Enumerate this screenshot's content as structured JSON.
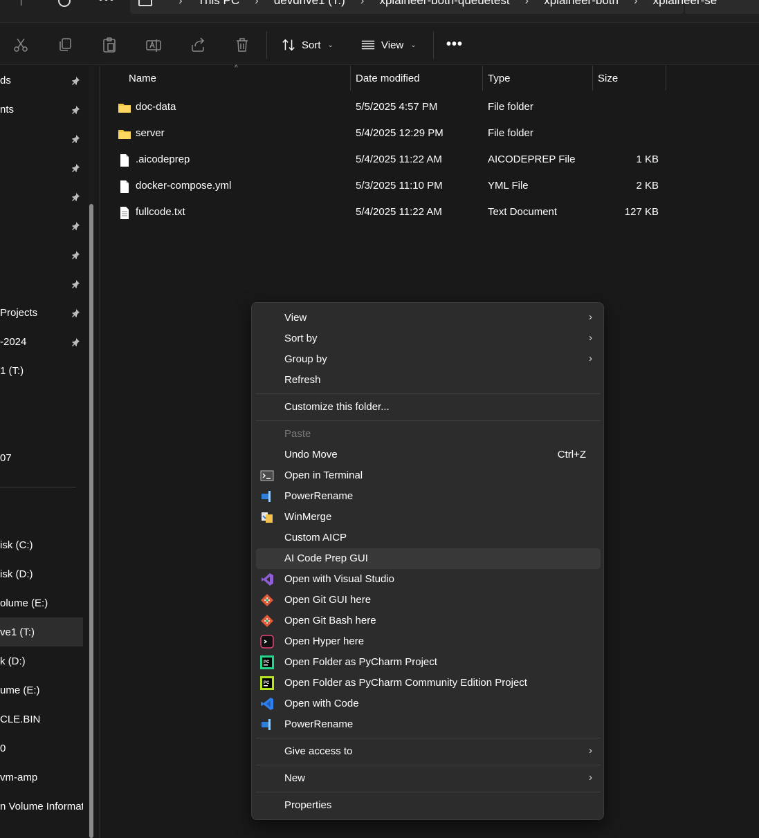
{
  "address_bar": {
    "crumbs": [
      "This PC",
      "devdrive1 (T:)",
      "xplaineer-both-queuetest",
      "xplaineer-both",
      "xplaineer-se"
    ]
  },
  "toolbar": {
    "icons": [
      "cut-icon",
      "copy-icon",
      "paste-icon",
      "rename-icon",
      "share-icon",
      "delete-icon"
    ],
    "sort_label": "Sort",
    "view_label": "View",
    "more_label": "•••"
  },
  "nav": {
    "items": [
      {
        "label": "ds",
        "pinned": true
      },
      {
        "label": "nts",
        "pinned": true
      },
      {
        "label": "",
        "pinned": true
      },
      {
        "label": "",
        "pinned": true
      },
      {
        "label": "",
        "pinned": true
      },
      {
        "label": "",
        "pinned": true
      },
      {
        "label": "",
        "pinned": true
      },
      {
        "label": "",
        "pinned": true
      },
      {
        "label": "Projects",
        "pinned": true
      },
      {
        "label": "-2024",
        "pinned": true
      },
      {
        "label": "1 (T:)",
        "pinned": false
      },
      {
        "label": "",
        "pinned": false
      },
      {
        "label": "",
        "pinned": false
      },
      {
        "label": "07",
        "pinned": false
      },
      {
        "label": "",
        "pinned": false
      },
      {
        "label": "",
        "pinned": false
      },
      {
        "label": "isk (C:)",
        "pinned": false
      },
      {
        "label": "isk (D:)",
        "pinned": false
      },
      {
        "label": "olume (E:)",
        "pinned": false
      },
      {
        "label": "ve1 (T:)",
        "pinned": false,
        "selected": true
      },
      {
        "label": "k (D:)",
        "pinned": false
      },
      {
        "label": "ume (E:)",
        "pinned": false
      },
      {
        "label": "CLE.BIN",
        "pinned": false
      },
      {
        "label": "0",
        "pinned": false
      },
      {
        "label": "vm-amp",
        "pinned": false
      },
      {
        "label": "n Volume Informati",
        "pinned": false
      }
    ]
  },
  "columns": {
    "name": "Name",
    "date": "Date modified",
    "type": "Type",
    "size": "Size"
  },
  "files": [
    {
      "name": "doc-data",
      "date": "5/5/2025 4:57 PM",
      "type": "File folder",
      "size": "",
      "icon": "folder-icon"
    },
    {
      "name": "server",
      "date": "5/4/2025 12:29 PM",
      "type": "File folder",
      "size": "",
      "icon": "folder-icon"
    },
    {
      "name": ".aicodeprep",
      "date": "5/4/2025 11:22 AM",
      "type": "AICODEPREP File",
      "size": "1 KB",
      "icon": "file-icon"
    },
    {
      "name": "docker-compose.yml",
      "date": "5/3/2025 11:10 PM",
      "type": "YML File",
      "size": "2 KB",
      "icon": "file-icon"
    },
    {
      "name": "fullcode.txt",
      "date": "5/4/2025 11:22 AM",
      "type": "Text Document",
      "size": "127 KB",
      "icon": "text-file-icon"
    }
  ],
  "context_menu": {
    "items": [
      {
        "label": "View",
        "submenu": true
      },
      {
        "label": "Sort by",
        "submenu": true
      },
      {
        "label": "Group by",
        "submenu": true
      },
      {
        "label": "Refresh"
      },
      {
        "separator": true
      },
      {
        "label": "Customize this folder..."
      },
      {
        "separator": true
      },
      {
        "label": "Paste",
        "disabled": true
      },
      {
        "label": "Undo Move",
        "shortcut": "Ctrl+Z"
      },
      {
        "label": "Open in Terminal",
        "icon": "terminal-icon"
      },
      {
        "label": "PowerRename",
        "icon": "powerrename-icon"
      },
      {
        "label": "WinMerge",
        "icon": "winmerge-icon"
      },
      {
        "label": "Custom AICP"
      },
      {
        "label": "AI Code Prep GUI",
        "hover": true
      },
      {
        "label": "Open with Visual Studio",
        "icon": "visual-studio-icon"
      },
      {
        "label": "Open Git GUI here",
        "icon": "git-icon"
      },
      {
        "label": "Open Git Bash here",
        "icon": "git-icon"
      },
      {
        "label": "Open Hyper here",
        "icon": "hyper-icon"
      },
      {
        "label": "Open Folder as PyCharm Project",
        "icon": "pycharm-icon"
      },
      {
        "label": "Open Folder as PyCharm Community Edition Project",
        "icon": "pycharm-community-icon"
      },
      {
        "label": "Open with Code",
        "icon": "vscode-icon"
      },
      {
        "label": "PowerRename",
        "icon": "powerrename-icon"
      },
      {
        "separator": true
      },
      {
        "label": "Give access to",
        "submenu": true
      },
      {
        "separator": true
      },
      {
        "label": "New",
        "submenu": true
      },
      {
        "separator": true
      },
      {
        "label": "Properties"
      }
    ]
  },
  "colors": {
    "background": "#191919",
    "menu_background": "#2c2c2c",
    "folder_yellow": "#f4c542",
    "vscode_blue": "#2f80ed",
    "vs_purple": "#8e5fd1"
  }
}
